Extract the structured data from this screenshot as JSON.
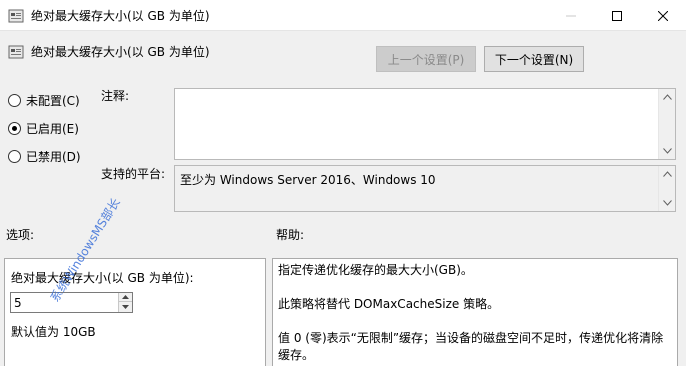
{
  "window": {
    "title": "绝对最大缓存大小(以 GB 为单位)"
  },
  "header": {
    "title": "绝对最大缓存大小(以 GB 为单位)",
    "prev_button": "上一个设置(P)",
    "next_button": "下一个设置(N)"
  },
  "state": {
    "options": [
      {
        "label": "未配置(C)",
        "checked": false
      },
      {
        "label": "已启用(E)",
        "checked": true
      },
      {
        "label": "已禁用(D)",
        "checked": false
      }
    ]
  },
  "comment": {
    "label": "注释:",
    "value": ""
  },
  "platform": {
    "label": "支持的平台:",
    "value": "至少为 Windows Server 2016、Windows 10"
  },
  "options_section": {
    "label": "选项:",
    "field_label": "绝对最大缓存大小(以 GB 为单位):",
    "field_value": "5",
    "default_text": "默认值为 10GB"
  },
  "help_section": {
    "label": "帮助:",
    "paragraphs": [
      "指定传递优化缓存的最大大小(GB)。",
      "此策略将替代 DOMaxCacheSize 策略。",
      "值 0 (零)表示“无限制”缓存；当设备的磁盘空间不足时，传递优化将清除缓存。"
    ]
  },
  "watermark": "系统WindowsMS部长",
  "colors": {
    "background": "#f0f0f0",
    "watermark": "#3a6fd8",
    "disabled_button": "#cccccc"
  }
}
